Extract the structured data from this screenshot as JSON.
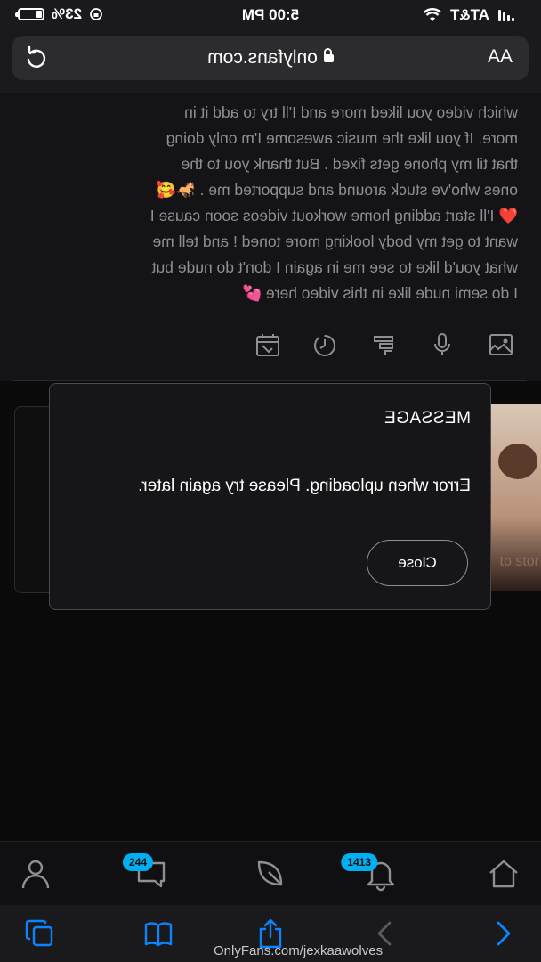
{
  "status_bar": {
    "carrier": "AT&T",
    "time": "5:00 PM",
    "battery": "23%",
    "battery_level": 0.23
  },
  "browser": {
    "text_size_label": "AA",
    "domain": "onlyfans.com"
  },
  "post": {
    "text_lines": [
      "which video you liked more and I'll try to add it in",
      "more. If you like the music awesome I'm only doing",
      "that til my phone gets fixed . But thank you to the",
      "ones who've stuck around and supported me . 🐎🥰",
      "❤️ I'll start adding home workout videos soon cause I",
      "want to get my body looking more toned ! and tell me",
      "what you'd like to see me in again I don't do nude but",
      "I do semi nude like in this video here 💕"
    ]
  },
  "modal": {
    "title": "MESSAGE",
    "message": "Error when uploading. Please try again later.",
    "close_label": "Close"
  },
  "thumbnail": {
    "caption": "to stor"
  },
  "app_nav": {
    "notifications_count": "1413",
    "messages_count": "244"
  },
  "toolbar": {
    "url_text": "OnlyFans.com/jexkaawolves"
  },
  "colors": {
    "accent": "#00aff0",
    "modal_bg": "#161618",
    "page_bg": "#0b0b0c",
    "safari_blue": "#0a84ff"
  }
}
